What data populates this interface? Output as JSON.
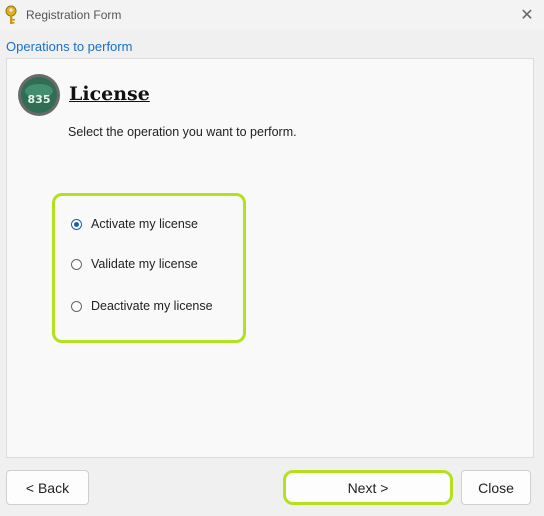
{
  "window": {
    "title": "Registration Form",
    "close_symbol": "✕"
  },
  "section": {
    "header": "Operations to perform"
  },
  "license": {
    "logo_text": "835",
    "heading": "License",
    "subtext": "Select the operation you want to perform."
  },
  "options": [
    {
      "label": "Activate my license",
      "selected": true
    },
    {
      "label": "Validate my license",
      "selected": false
    },
    {
      "label": "Deactivate my license",
      "selected": false
    }
  ],
  "buttons": {
    "back": "< Back",
    "next": "Next >",
    "close": "Close"
  },
  "colors": {
    "highlight": "#b4e01e",
    "link_blue": "#1a6fc9",
    "radio_blue": "#1a5fb4"
  }
}
